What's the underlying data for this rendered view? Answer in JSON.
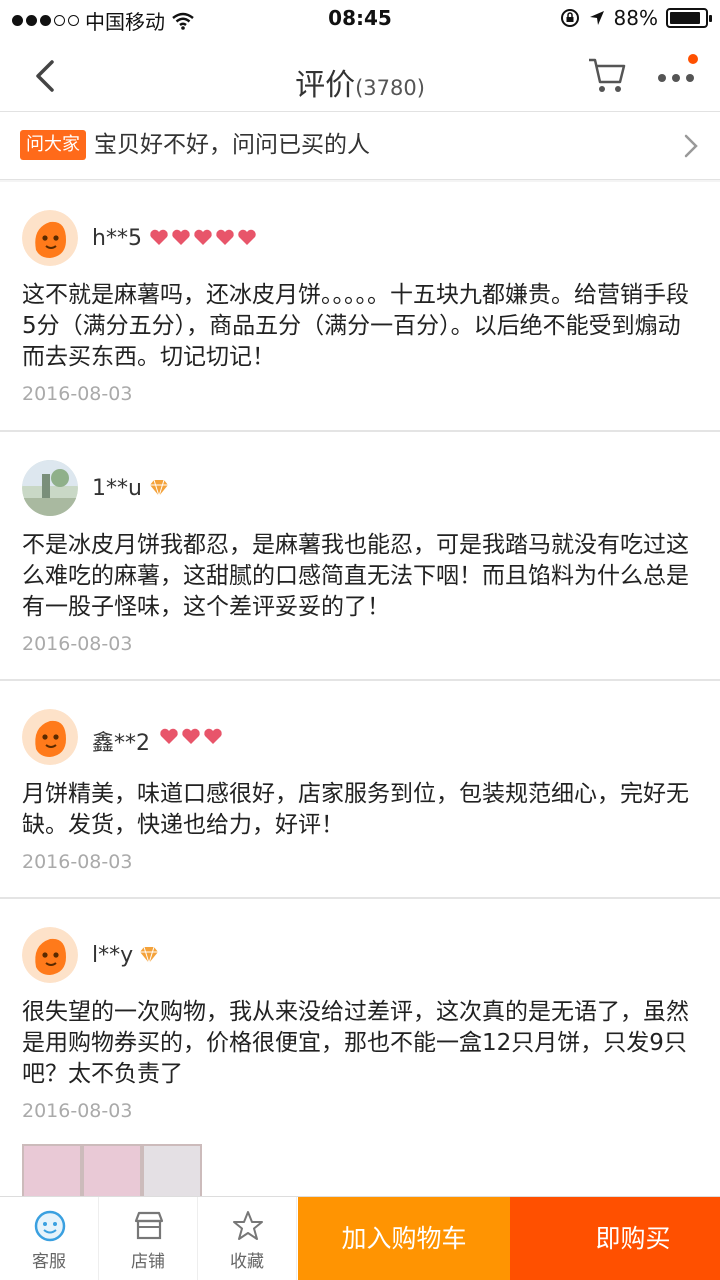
{
  "status_bar": {
    "carrier": "中国移动",
    "time": "08:45",
    "battery_percent": "88%",
    "battery_level": 0.88
  },
  "nav": {
    "title": "评价",
    "count": "(3780)"
  },
  "ask": {
    "badge": "问大家",
    "text": "宝贝好不好，问问已买的人"
  },
  "reviews": [
    {
      "user": "h**5",
      "level_icon": "heart-level-icon",
      "level_count": 5,
      "text": "这不就是麻薯吗，还冰皮月饼。。。。。十五块九都嫌贵。给营销手段5分（满分五分），商品五分（满分一百分）。以后绝不能受到煽动而去买东西。切记切记！",
      "date": "2016-08-03",
      "avatar": "orange-mascot"
    },
    {
      "user": "1**u",
      "level_icon": "diamond-level-icon",
      "level_count": 1,
      "text": "不是冰皮月饼我都忍，是麻薯我也能忍，可是我踏马就没有吃过这么难吃的麻薯，这甜腻的口感简直无法下咽！而且馅料为什么总是有一股子怪味，这个差评妥妥的了！",
      "date": "2016-08-03",
      "avatar": "photo"
    },
    {
      "user": "鑫**2",
      "level_icon": "heart-level-icon",
      "level_count": 3,
      "text": "月饼精美，味道口感很好，店家服务到位，包装规范细心，完好无缺。发货，快递也给力，好评！",
      "date": "2016-08-03",
      "avatar": "orange-mascot"
    },
    {
      "user": "l**y",
      "level_icon": "diamond-level-icon",
      "level_count": 1,
      "text": "很失望的一次购物，我从来没给过差评，这次真的是无语了，虽然是用购物券买的，价格很便宜，那也不能一盒12只月饼，只发9只吧？太不负责了",
      "date": "2016-08-03",
      "avatar": "orange-mascot"
    }
  ],
  "bottom": {
    "tabs": [
      {
        "label": "客服",
        "icon": "service-icon"
      },
      {
        "label": "店铺",
        "icon": "shop-icon"
      },
      {
        "label": "收藏",
        "icon": "star-icon"
      }
    ],
    "add_cart": "加入购物车",
    "buy_now": "即购买"
  },
  "colors": {
    "accent_orange": "#ff9402",
    "accent_red": "#ff5000",
    "heart": "#e8556a",
    "diamond": "#f4a23a"
  }
}
